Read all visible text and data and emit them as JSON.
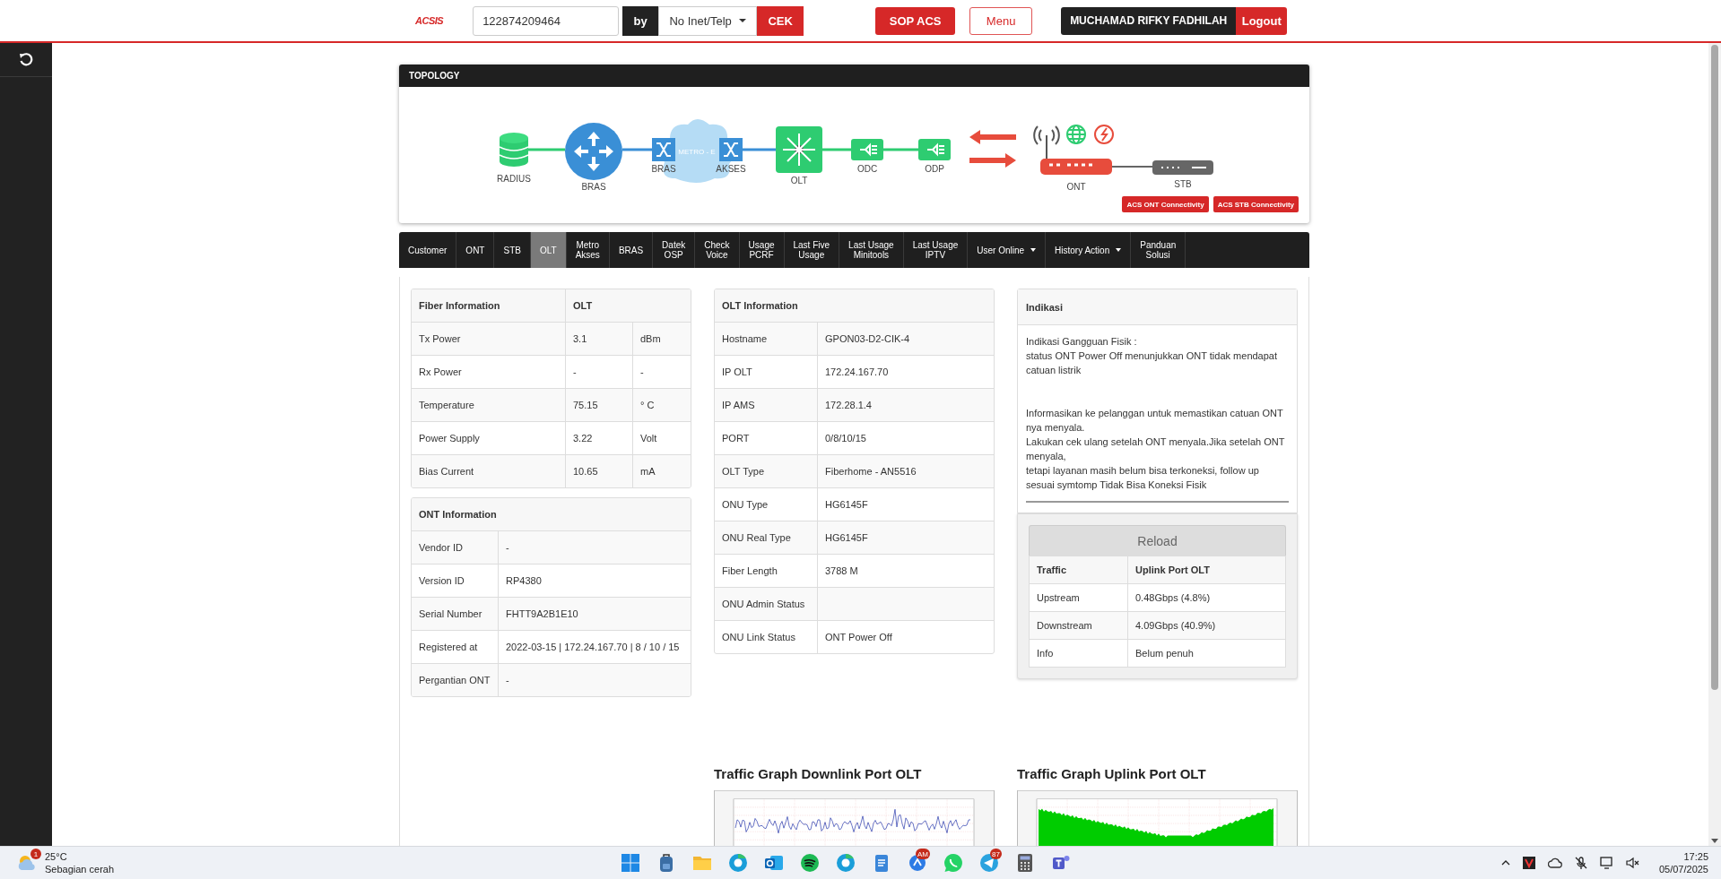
{
  "top_bar": {
    "logo": "ACSIS",
    "search_field": {
      "value": "122874209464"
    },
    "by_label": "by",
    "search_type": "No Inet/Telp",
    "check_button": "CEK",
    "sop_button": "SOP ACS",
    "menu_button": "Menu",
    "user_name": "MUCHAMAD RIFKY FADHILAH",
    "logout_button": "Logout"
  },
  "topology": {
    "title": "TOPOLOGY",
    "nodes": [
      {
        "kind": "database",
        "label": "RADIUS"
      },
      {
        "kind": "router",
        "label": "BRAS"
      },
      {
        "kind": "switch",
        "label": "BRAS"
      },
      {
        "kind": "cloud",
        "label": "METRO - E"
      },
      {
        "kind": "switch",
        "label": "AKSES"
      },
      {
        "kind": "olt",
        "label": "OLT"
      },
      {
        "kind": "splitter",
        "label": "ODC"
      },
      {
        "kind": "splitter",
        "label": "ODP"
      },
      {
        "kind": "ont",
        "label": "ONT"
      },
      {
        "kind": "stb",
        "label": "STB"
      }
    ],
    "buttons": [
      "ACS ONT Connectivity",
      "ACS STB Connectivity"
    ]
  },
  "tabs": [
    {
      "label": "Customer",
      "selected": false
    },
    {
      "label": "ONT",
      "selected": false
    },
    {
      "label": "STB",
      "selected": false
    },
    {
      "label": "OLT",
      "selected": true
    },
    {
      "label": "Metro\nAkses",
      "selected": false
    },
    {
      "label": "BRAS",
      "selected": false
    },
    {
      "label": "Datek\nOSP",
      "selected": false
    },
    {
      "label": "Check\nVoice",
      "selected": false
    },
    {
      "label": "Usage\nPCRF",
      "selected": false
    },
    {
      "label": "Last Five\nUsage",
      "selected": false
    },
    {
      "label": "Last Usage\nMinitools",
      "selected": false
    },
    {
      "label": "Last Usage\nIPTV",
      "selected": false
    },
    {
      "label": "User Online",
      "selected": false,
      "has_menu": true
    },
    {
      "label": "History Action",
      "selected": false,
      "has_menu": true
    },
    {
      "label": "Panduan\nSolusi",
      "selected": false
    }
  ],
  "fiber_information": {
    "header": {
      "label": "Fiber Information",
      "olt": "OLT"
    },
    "rows": [
      {
        "label": "Tx Power",
        "value": "3.1",
        "unit": "dBm"
      },
      {
        "label": "Rx Power",
        "value": "-",
        "unit": "-"
      },
      {
        "label": "Temperature",
        "value": "75.15",
        "unit": "° C"
      },
      {
        "label": "Power Supply",
        "value": "3.22",
        "unit": "Volt"
      },
      {
        "label": "Bias Current",
        "value": "10.65",
        "unit": "mA"
      }
    ]
  },
  "ont_information": {
    "title": "ONT Information",
    "rows": [
      [
        "Vendor ID",
        "-"
      ],
      [
        "Version ID",
        "RP4380"
      ],
      [
        "Serial Number",
        "FHTT9A2B1E10"
      ],
      [
        "Registered at",
        "2022-03-15 | 172.24.167.70 | 8 / 10 / 15"
      ],
      [
        "Pergantian ONT",
        "-"
      ]
    ]
  },
  "olt_information": {
    "title": "OLT Information",
    "rows": [
      [
        "Hostname",
        "GPON03-D2-CIK-4"
      ],
      [
        "IP OLT",
        "172.24.167.70"
      ],
      [
        "IP AMS",
        "172.28.1.4"
      ],
      [
        "PORT",
        "0/8/10/15"
      ],
      [
        "OLT Type",
        "Fiberhome - AN5516"
      ],
      [
        "ONU Type",
        "HG6145F"
      ],
      [
        "ONU Real Type",
        "HG6145F"
      ],
      [
        "Fiber Length",
        "3788 M"
      ],
      [
        "ONU Admin Status"
      ],
      [
        "ONU Link Status",
        "ONT Power Off"
      ]
    ]
  },
  "indikasi": {
    "title": "Indikasi",
    "text": "Indikasi Gangguan Fisik :\nstatus ONT Power Off menunjukkan ONT tidak mendapat catuan listrik\n\n\nInformasikan ke pelanggan untuk memastikan catuan ONT nya menyala.\nLakukan cek ulang setelah ONT menyala.Jika setelah ONT menyala,\ntetapi layanan masih belum bisa terkoneksi, follow up sesuai symtomp Tidak Bisa Koneksi Fisik"
  },
  "traffic": {
    "reload_button": "Reload",
    "columns": [
      "Traffic",
      "Uplink Port OLT"
    ],
    "rows": [
      [
        "Upstream",
        "0.48Gbps (4.8%)"
      ],
      [
        "Downstream",
        "4.09Gbps (40.9%)"
      ],
      [
        "Info",
        "Belum penuh"
      ]
    ]
  },
  "graphs": [
    {
      "title": "Traffic Graph Downlink Port OLT",
      "kind": "line"
    },
    {
      "title": "Traffic Graph Uplink Port OLT",
      "kind": "area"
    }
  ],
  "taskbar": {
    "weather": {
      "temperature": "25°C",
      "condition": "Sebagian cerah",
      "badge": "1"
    },
    "apps": [
      {
        "kind": "start"
      },
      {
        "kind": "backpack"
      },
      {
        "kind": "folder"
      },
      {
        "kind": "browser"
      },
      {
        "kind": "mail"
      },
      {
        "kind": "music"
      },
      {
        "kind": "browser"
      },
      {
        "kind": "notepad"
      },
      {
        "kind": "avatar",
        "badge": "AM"
      },
      {
        "kind": "chat"
      },
      {
        "kind": "send",
        "badge": "87"
      },
      {
        "kind": "calculator"
      },
      {
        "kind": "people"
      }
    ],
    "time": "17:25",
    "date": "05/07/2025"
  }
}
